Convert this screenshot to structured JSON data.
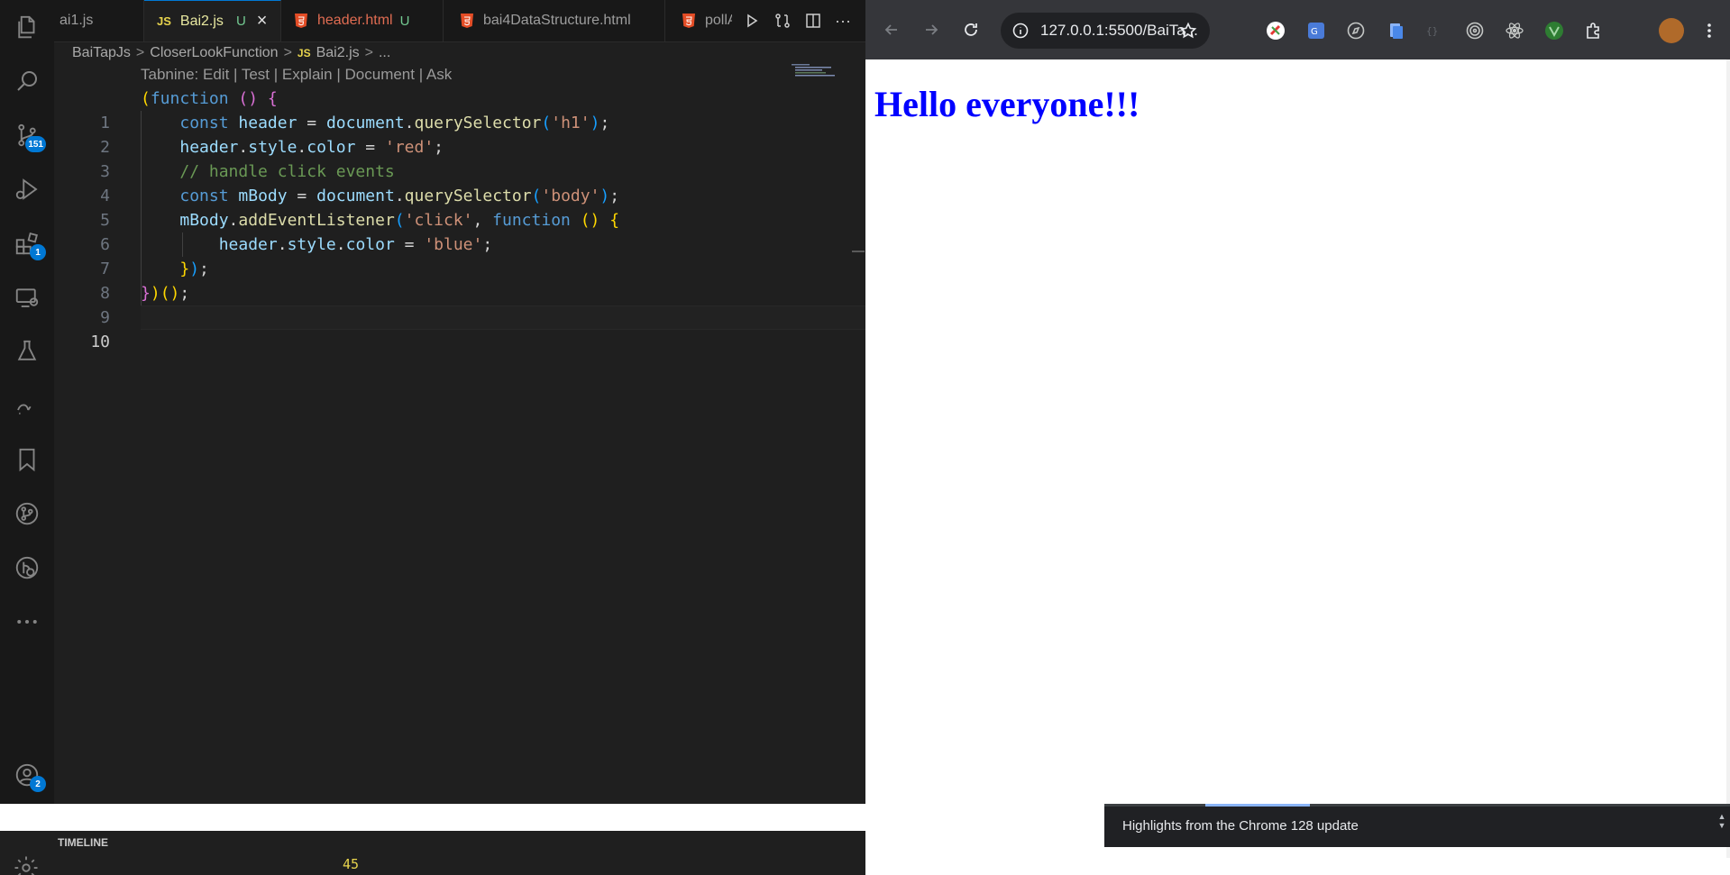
{
  "vscode": {
    "tabs": [
      {
        "label": "ai1.js",
        "type": "js"
      },
      {
        "label": "Bai2.js",
        "type": "js",
        "badge": "U",
        "active": true
      },
      {
        "label": "header.html",
        "type": "html",
        "badge": "U"
      },
      {
        "label": "bai4DataStructure.html",
        "type": "html"
      },
      {
        "label": "pollAp",
        "type": "html"
      }
    ],
    "js_icon": "JS",
    "close_glyph": "×",
    "more_glyph": "···",
    "breadcrumb": [
      "BaiTapJs",
      "CloserLookFunction",
      "Bai2.js",
      "..."
    ],
    "breadcrumb_sep": ">",
    "codelens": "Tabnine: Edit | Test | Explain | Document | Ask",
    "activity_badges": {
      "source_control": "151",
      "extensions": "1",
      "accounts": "2"
    },
    "line_numbers": [
      "1",
      "2",
      "3",
      "4",
      "5",
      "6",
      "7",
      "8",
      "9",
      "10"
    ],
    "bottom": {
      "timeline": "TIMELINE",
      "number": "45"
    }
  },
  "code_tokens": {
    "l1": [
      "(",
      "function",
      " ",
      "()",
      " ",
      "{"
    ],
    "l2": [
      "const",
      "header",
      "=",
      "document",
      ".",
      "querySelector",
      "(",
      "'h1'",
      ")",
      ";"
    ],
    "l3": [
      "header",
      ".",
      "style",
      ".",
      "color",
      "=",
      "'red'",
      ";"
    ],
    "l4": "// handle click events",
    "l5": [
      "const",
      "mBody",
      "=",
      "document",
      ".",
      "querySelector",
      "(",
      "'body'",
      ")",
      ";"
    ],
    "l6": [
      "mBody",
      ".",
      "addEventListener",
      "(",
      "'click'",
      ",",
      "function",
      "()",
      "{"
    ],
    "l7": [
      "header",
      ".",
      "style",
      ".",
      "color",
      "=",
      "'blue'",
      ";"
    ],
    "l8": [
      "}",
      ")",
      ";"
    ],
    "l9": [
      "}",
      ")",
      "()",
      ";"
    ]
  },
  "chrome": {
    "url": "127.0.0.1:5500/BaiTa...",
    "heading": "Hello everyone!!!",
    "notification": "Highlights from the Chrome 128 update",
    "colors": {
      "heading": "#0000ff",
      "toolbar": "#35363a"
    }
  }
}
